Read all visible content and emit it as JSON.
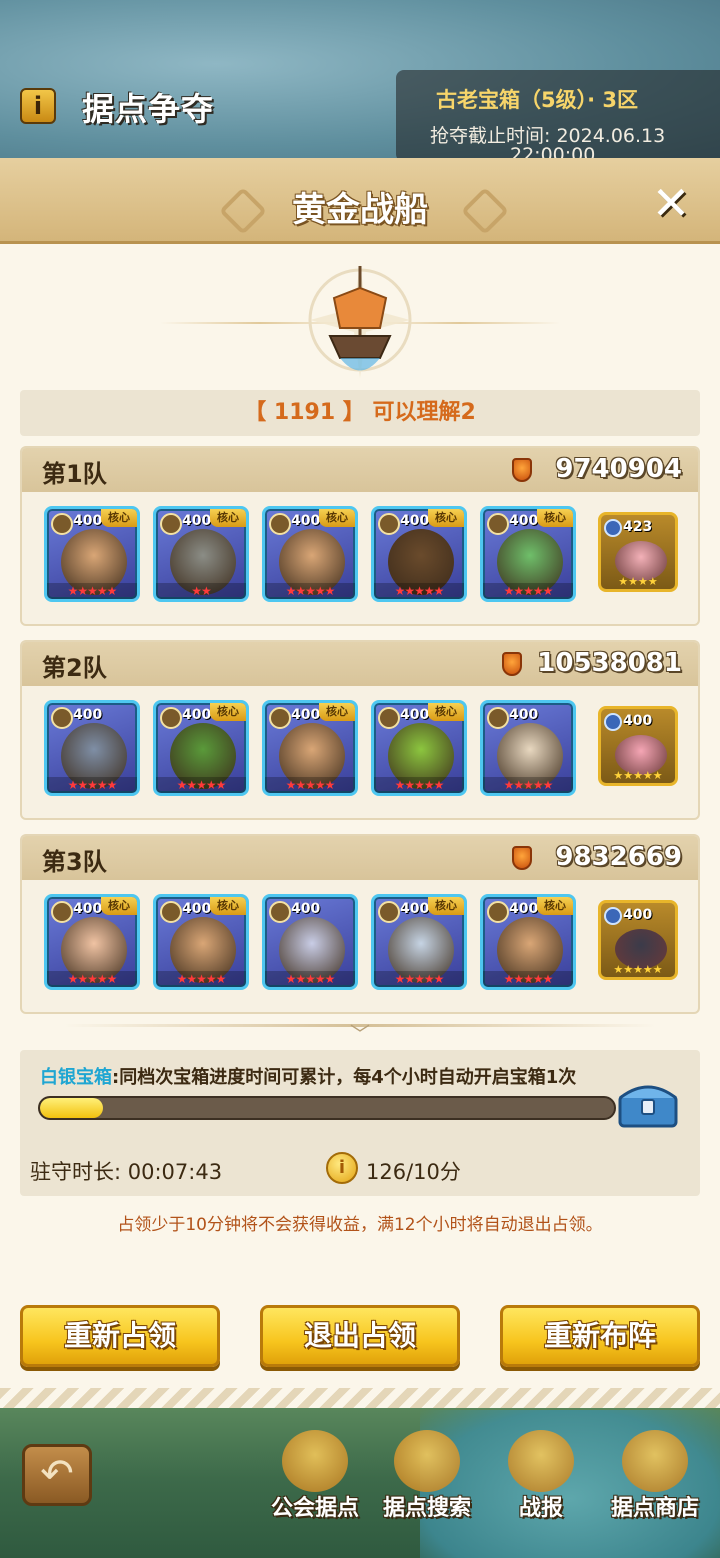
{
  "header": {
    "info_label": "i",
    "title": "据点争夺",
    "chest_title": "古老宝箱（5级）· 3区",
    "deadline_label": "抢夺截止时间: 2024.06.13",
    "deadline_time": "22:00:00"
  },
  "dialog": {
    "title": "黄金战船",
    "close": "✕",
    "owner": "【 1191 】 可以理解2"
  },
  "teams": [
    {
      "name": "第1队",
      "power": "9740904",
      "heroes": [
        {
          "level": "400",
          "core": "核心",
          "stars": "★★★★★",
          "color": "#d9a676"
        },
        {
          "level": "400",
          "core": "核心",
          "stars": "★★",
          "color": "#8b8d86"
        },
        {
          "level": "400",
          "core": "核心",
          "stars": "★★★★★",
          "color": "#d9a676"
        },
        {
          "level": "400",
          "core": "核心",
          "stars": "★★★★★",
          "color": "#6a4b2c"
        },
        {
          "level": "400",
          "core": "核心",
          "stars": "★★★★★",
          "color": "#6fbf6a"
        }
      ],
      "pet": {
        "level": "423",
        "stars": "★★★★",
        "color": "#f3b1b8"
      }
    },
    {
      "name": "第2队",
      "power": "10538081",
      "heroes": [
        {
          "level": "400",
          "core": "",
          "stars": "★★★★★",
          "color": "#7f8fa6"
        },
        {
          "level": "400",
          "core": "核心",
          "stars": "★★★★★",
          "color": "#5a9a3a"
        },
        {
          "level": "400",
          "core": "核心",
          "stars": "★★★★★",
          "color": "#d9a676"
        },
        {
          "level": "400",
          "core": "核心",
          "stars": "★★★★★",
          "color": "#8cc63f"
        },
        {
          "level": "400",
          "core": "",
          "stars": "★★★★★",
          "color": "#e8d8c0"
        }
      ],
      "pet": {
        "level": "400",
        "stars": "★★★★★",
        "color": "#f5a6b5"
      }
    },
    {
      "name": "第3队",
      "power": "9832669",
      "heroes": [
        {
          "level": "400",
          "core": "核心",
          "stars": "★★★★★",
          "color": "#f0c3a3"
        },
        {
          "level": "400",
          "core": "核心",
          "stars": "★★★★★",
          "color": "#d9a676"
        },
        {
          "level": "400",
          "core": "",
          "stars": "★★★★★",
          "color": "#c9cde6"
        },
        {
          "level": "400",
          "core": "核心",
          "stars": "★★★★★",
          "color": "#c6d4e4"
        },
        {
          "level": "400",
          "core": "核心",
          "stars": "★★★★★",
          "color": "#d9a676"
        }
      ],
      "pet": {
        "level": "400",
        "stars": "★★★★★",
        "color": "#3b3b4a"
      }
    }
  ],
  "progress": {
    "label_highlight": "白银宝箱",
    "label_rest": ":同档次宝箱进度时间可累计，每4个小时自动开启宝箱1次",
    "value": 0.11,
    "garrison": "驻守时长: 00:07:43",
    "coin_glyph": "i",
    "score": "126/10分",
    "notice": "占领少于10分钟将不会获得收益，满12个小时将自动退出占领。"
  },
  "buttons": {
    "reoccupy": "重新占领",
    "exit": "退出占领",
    "redeploy": "重新布阵"
  },
  "nav": {
    "back": "↶",
    "guild": "公会据点",
    "search": "据点搜索",
    "report": "战报",
    "shop": "据点商店"
  }
}
